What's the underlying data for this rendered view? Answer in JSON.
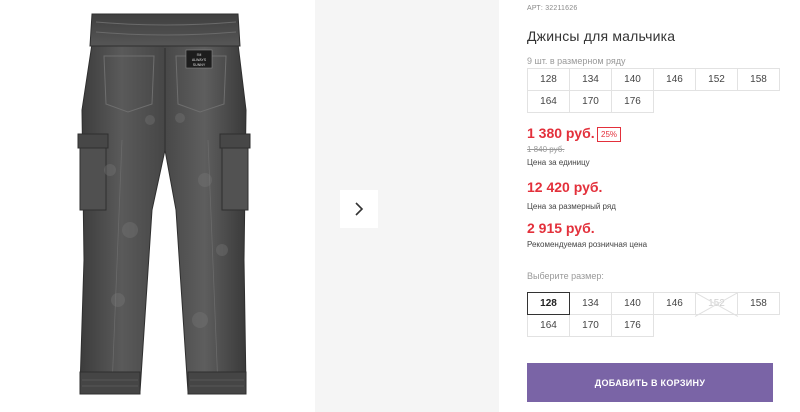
{
  "gallery": {
    "next_icon": "chevron-right-icon",
    "product_image": "grey denim jogger jeans with cargo pockets and cuffed ankles",
    "badge_line1": "I'M",
    "badge_line2": "ALWAYS",
    "badge_line3": "SUNNY"
  },
  "product": {
    "sku": "АРТ: 32211626",
    "title": "Джинсы для мальчика",
    "pack_label": "9 шт. в размерном ряду",
    "pack_sizes": [
      "128",
      "134",
      "140",
      "146",
      "152",
      "158",
      "164",
      "170",
      "176"
    ],
    "price_unit": "1 380 руб.",
    "discount": "25%",
    "price_old": "1 840 руб.",
    "price_unit_caption": "Цена за единицу",
    "price_row": "12 420 руб.",
    "price_row_caption": "Цена за размерный ряд",
    "price_rrp": "2 915 руб.",
    "price_rrp_caption": "Рекомендуемая розничная цена",
    "choose_label": "Выберите размер:",
    "choose_sizes": [
      {
        "label": "128",
        "state": "selected"
      },
      {
        "label": "134",
        "state": "available"
      },
      {
        "label": "140",
        "state": "available"
      },
      {
        "label": "146",
        "state": "available"
      },
      {
        "label": "152",
        "state": "unavailable"
      },
      {
        "label": "158",
        "state": "available"
      },
      {
        "label": "164",
        "state": "available"
      },
      {
        "label": "170",
        "state": "available"
      },
      {
        "label": "176",
        "state": "available"
      }
    ],
    "add_to_cart": "ДОБАВИТЬ В КОРЗИНУ"
  },
  "colors": {
    "price_red": "#e3303b",
    "button_purple": "#7a64a6",
    "denim_grey": "#4a4a4a"
  }
}
